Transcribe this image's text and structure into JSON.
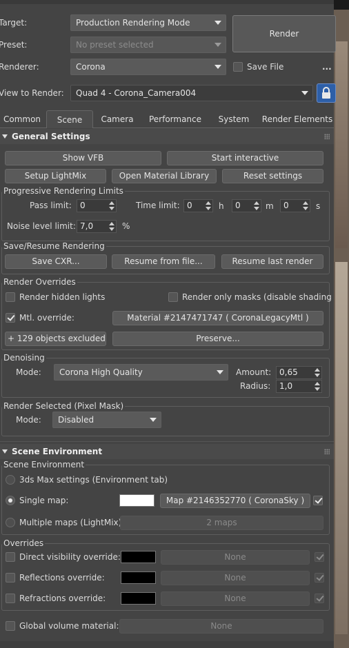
{
  "header": {
    "target_label": "Target:",
    "target_value": "Production Rendering Mode",
    "preset_label": "Preset:",
    "preset_value": "No preset selected",
    "renderer_label": "Renderer:",
    "renderer_value": "Corona",
    "save_file_label": "Save File",
    "ellipsis": "...",
    "render_button": "Render",
    "view_label": "View to Render:",
    "view_value": "Quad 4 - Corona_Camera004"
  },
  "tabs": [
    {
      "label": "Common"
    },
    {
      "label": "Scene"
    },
    {
      "label": "Camera"
    },
    {
      "label": "Performance"
    },
    {
      "label": "System"
    },
    {
      "label": "Render Elements"
    }
  ],
  "general": {
    "title": "General Settings",
    "show_vfb": "Show VFB",
    "start_interactive": "Start interactive",
    "setup_lightmix": "Setup LightMix",
    "open_material_library": "Open Material Library",
    "reset_settings": "Reset settings",
    "progressive": {
      "title": "Progressive Rendering Limits",
      "pass_label": "Pass limit:",
      "pass_value": "0",
      "time_label": "Time limit:",
      "hours": "0",
      "h": "h",
      "minutes": "0",
      "m": "m",
      "seconds": "0",
      "s": "s",
      "noise_label": "Noise level limit:",
      "noise_value": "7,0",
      "percent": "%"
    },
    "save_resume": {
      "title": "Save/Resume Rendering",
      "save_cxr": "Save CXR...",
      "resume_file": "Resume from file...",
      "resume_last": "Resume last render"
    },
    "overrides": {
      "title": "Render Overrides",
      "hidden_lights": "Render hidden lights",
      "only_masks": "Render only masks (disable shading",
      "mtl_override": "Mtl. override:",
      "material": "Material #2147471747  ( CoronaLegacyMtl )",
      "excluded": "+ 129 objects excluded..",
      "preserve": "Preserve..."
    },
    "denoising": {
      "title": "Denoising",
      "mode_label": "Mode:",
      "mode_value": "Corona High Quality",
      "amount_label": "Amount:",
      "amount_value": "0,65",
      "radius_label": "Radius:",
      "radius_value": "1,0"
    },
    "pixel_mask": {
      "title": "Render Selected (Pixel Mask)",
      "mode_label": "Mode:",
      "mode_value": "Disabled"
    }
  },
  "scene_env": {
    "title": "Scene Environment",
    "group_title": "Scene Environment",
    "max_settings": "3ds Max settings (Environment tab)",
    "single_map": "Single map:",
    "map_name": "Map #2146352770  ( CoronaSky )",
    "multiple_maps": "Multiple maps (LightMix):",
    "maps_count": "2 maps",
    "overrides_title": "Overrides",
    "direct": "Direct visibility override:",
    "reflections": "Reflections override:",
    "refractions": "Refractions override:",
    "none": "None",
    "global_volume": "Global volume material:"
  },
  "colors": {
    "panel": "#444444",
    "swatch_white": "#ffffff",
    "swatch_black": "#000000",
    "lock_accent": "#2d5fa8"
  }
}
